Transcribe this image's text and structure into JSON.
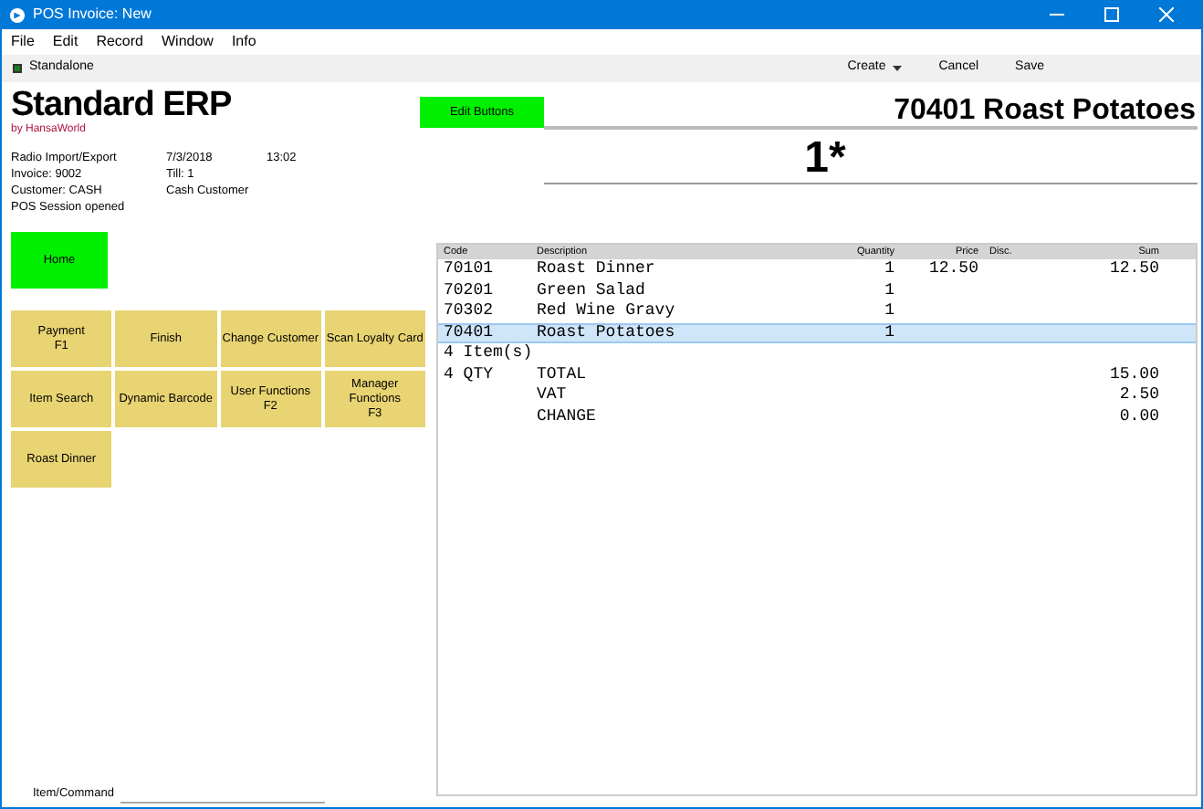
{
  "window": {
    "title": "POS Invoice: New"
  },
  "menu": [
    "File",
    "Edit",
    "Record",
    "Window",
    "Info"
  ],
  "toolbar": {
    "mode": "Standalone",
    "actions": [
      {
        "label": "Create",
        "dropdown": true
      },
      {
        "label": "Cancel",
        "dropdown": false
      },
      {
        "label": "Save",
        "dropdown": false
      }
    ]
  },
  "logo": {
    "name": "Standard ERP",
    "byline": "by HansaWorld"
  },
  "edit_button": "Edit Buttons",
  "current_item": "70401 Roast Potatoes",
  "quantity_display": "1*",
  "info": [
    [
      "Radio Import/Export",
      "7/3/2018",
      "13:02"
    ],
    [
      "Invoice: 9002",
      "Till: 1"
    ],
    [
      "Customer: CASH",
      "Cash Customer"
    ],
    [
      "POS Session opened"
    ]
  ],
  "home_button": "Home",
  "function_buttons": [
    [
      "Payment",
      "F1"
    ],
    [
      "Finish"
    ],
    [
      "Change Customer"
    ],
    [
      "Scan Loyalty Card"
    ],
    [
      "Item Search"
    ],
    [
      "Dynamic Barcode"
    ],
    [
      "User Functions",
      "F2"
    ],
    [
      "Manager Functions",
      "F3"
    ],
    [
      "Roast Dinner"
    ]
  ],
  "table": {
    "columns": [
      "Code",
      "Description",
      "Quantity",
      "Price",
      "Disc.",
      "Sum"
    ],
    "rows": [
      {
        "kind": "item",
        "selected": false,
        "cells": [
          "70101",
          "Roast Dinner",
          "1",
          "12.50",
          "",
          "12.50"
        ]
      },
      {
        "kind": "item",
        "selected": false,
        "cells": [
          "70201",
          "Green Salad",
          "1",
          "",
          "",
          ""
        ]
      },
      {
        "kind": "item",
        "selected": false,
        "cells": [
          "70302",
          "Red Wine Gravy",
          "1",
          "",
          "",
          ""
        ]
      },
      {
        "kind": "item",
        "selected": true,
        "cells": [
          "70401",
          "Roast Potatoes",
          "1",
          "",
          "",
          ""
        ]
      },
      {
        "kind": "note",
        "selected": false,
        "cells": [
          "4 Item(s)"
        ]
      },
      {
        "kind": "item",
        "selected": false,
        "cells": [
          "4 QTY",
          "TOTAL",
          "",
          "",
          "",
          "15.00"
        ]
      },
      {
        "kind": "item",
        "selected": false,
        "cells": [
          "",
          "VAT",
          "",
          "",
          "",
          "2.50"
        ]
      },
      {
        "kind": "item",
        "selected": false,
        "cells": [
          "",
          "CHANGE",
          "",
          "",
          "",
          "0.00"
        ]
      }
    ]
  },
  "command_field": {
    "label": "Item/Command"
  }
}
